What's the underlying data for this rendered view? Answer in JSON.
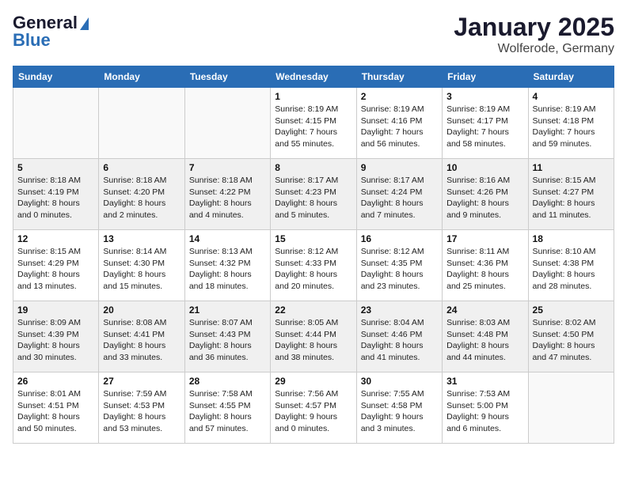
{
  "header": {
    "logo_general": "General",
    "logo_blue": "Blue",
    "month_title": "January 2025",
    "location": "Wolferode, Germany"
  },
  "weekdays": [
    "Sunday",
    "Monday",
    "Tuesday",
    "Wednesday",
    "Thursday",
    "Friday",
    "Saturday"
  ],
  "weeks": [
    {
      "shaded": false,
      "days": [
        {
          "num": "",
          "sunrise": "",
          "sunset": "",
          "daylight": ""
        },
        {
          "num": "",
          "sunrise": "",
          "sunset": "",
          "daylight": ""
        },
        {
          "num": "",
          "sunrise": "",
          "sunset": "",
          "daylight": ""
        },
        {
          "num": "1",
          "sunrise": "Sunrise: 8:19 AM",
          "sunset": "Sunset: 4:15 PM",
          "daylight": "Daylight: 7 hours and 55 minutes."
        },
        {
          "num": "2",
          "sunrise": "Sunrise: 8:19 AM",
          "sunset": "Sunset: 4:16 PM",
          "daylight": "Daylight: 7 hours and 56 minutes."
        },
        {
          "num": "3",
          "sunrise": "Sunrise: 8:19 AM",
          "sunset": "Sunset: 4:17 PM",
          "daylight": "Daylight: 7 hours and 58 minutes."
        },
        {
          "num": "4",
          "sunrise": "Sunrise: 8:19 AM",
          "sunset": "Sunset: 4:18 PM",
          "daylight": "Daylight: 7 hours and 59 minutes."
        }
      ]
    },
    {
      "shaded": true,
      "days": [
        {
          "num": "5",
          "sunrise": "Sunrise: 8:18 AM",
          "sunset": "Sunset: 4:19 PM",
          "daylight": "Daylight: 8 hours and 0 minutes."
        },
        {
          "num": "6",
          "sunrise": "Sunrise: 8:18 AM",
          "sunset": "Sunset: 4:20 PM",
          "daylight": "Daylight: 8 hours and 2 minutes."
        },
        {
          "num": "7",
          "sunrise": "Sunrise: 8:18 AM",
          "sunset": "Sunset: 4:22 PM",
          "daylight": "Daylight: 8 hours and 4 minutes."
        },
        {
          "num": "8",
          "sunrise": "Sunrise: 8:17 AM",
          "sunset": "Sunset: 4:23 PM",
          "daylight": "Daylight: 8 hours and 5 minutes."
        },
        {
          "num": "9",
          "sunrise": "Sunrise: 8:17 AM",
          "sunset": "Sunset: 4:24 PM",
          "daylight": "Daylight: 8 hours and 7 minutes."
        },
        {
          "num": "10",
          "sunrise": "Sunrise: 8:16 AM",
          "sunset": "Sunset: 4:26 PM",
          "daylight": "Daylight: 8 hours and 9 minutes."
        },
        {
          "num": "11",
          "sunrise": "Sunrise: 8:15 AM",
          "sunset": "Sunset: 4:27 PM",
          "daylight": "Daylight: 8 hours and 11 minutes."
        }
      ]
    },
    {
      "shaded": false,
      "days": [
        {
          "num": "12",
          "sunrise": "Sunrise: 8:15 AM",
          "sunset": "Sunset: 4:29 PM",
          "daylight": "Daylight: 8 hours and 13 minutes."
        },
        {
          "num": "13",
          "sunrise": "Sunrise: 8:14 AM",
          "sunset": "Sunset: 4:30 PM",
          "daylight": "Daylight: 8 hours and 15 minutes."
        },
        {
          "num": "14",
          "sunrise": "Sunrise: 8:13 AM",
          "sunset": "Sunset: 4:32 PM",
          "daylight": "Daylight: 8 hours and 18 minutes."
        },
        {
          "num": "15",
          "sunrise": "Sunrise: 8:12 AM",
          "sunset": "Sunset: 4:33 PM",
          "daylight": "Daylight: 8 hours and 20 minutes."
        },
        {
          "num": "16",
          "sunrise": "Sunrise: 8:12 AM",
          "sunset": "Sunset: 4:35 PM",
          "daylight": "Daylight: 8 hours and 23 minutes."
        },
        {
          "num": "17",
          "sunrise": "Sunrise: 8:11 AM",
          "sunset": "Sunset: 4:36 PM",
          "daylight": "Daylight: 8 hours and 25 minutes."
        },
        {
          "num": "18",
          "sunrise": "Sunrise: 8:10 AM",
          "sunset": "Sunset: 4:38 PM",
          "daylight": "Daylight: 8 hours and 28 minutes."
        }
      ]
    },
    {
      "shaded": true,
      "days": [
        {
          "num": "19",
          "sunrise": "Sunrise: 8:09 AM",
          "sunset": "Sunset: 4:39 PM",
          "daylight": "Daylight: 8 hours and 30 minutes."
        },
        {
          "num": "20",
          "sunrise": "Sunrise: 8:08 AM",
          "sunset": "Sunset: 4:41 PM",
          "daylight": "Daylight: 8 hours and 33 minutes."
        },
        {
          "num": "21",
          "sunrise": "Sunrise: 8:07 AM",
          "sunset": "Sunset: 4:43 PM",
          "daylight": "Daylight: 8 hours and 36 minutes."
        },
        {
          "num": "22",
          "sunrise": "Sunrise: 8:05 AM",
          "sunset": "Sunset: 4:44 PM",
          "daylight": "Daylight: 8 hours and 38 minutes."
        },
        {
          "num": "23",
          "sunrise": "Sunrise: 8:04 AM",
          "sunset": "Sunset: 4:46 PM",
          "daylight": "Daylight: 8 hours and 41 minutes."
        },
        {
          "num": "24",
          "sunrise": "Sunrise: 8:03 AM",
          "sunset": "Sunset: 4:48 PM",
          "daylight": "Daylight: 8 hours and 44 minutes."
        },
        {
          "num": "25",
          "sunrise": "Sunrise: 8:02 AM",
          "sunset": "Sunset: 4:50 PM",
          "daylight": "Daylight: 8 hours and 47 minutes."
        }
      ]
    },
    {
      "shaded": false,
      "days": [
        {
          "num": "26",
          "sunrise": "Sunrise: 8:01 AM",
          "sunset": "Sunset: 4:51 PM",
          "daylight": "Daylight: 8 hours and 50 minutes."
        },
        {
          "num": "27",
          "sunrise": "Sunrise: 7:59 AM",
          "sunset": "Sunset: 4:53 PM",
          "daylight": "Daylight: 8 hours and 53 minutes."
        },
        {
          "num": "28",
          "sunrise": "Sunrise: 7:58 AM",
          "sunset": "Sunset: 4:55 PM",
          "daylight": "Daylight: 8 hours and 57 minutes."
        },
        {
          "num": "29",
          "sunrise": "Sunrise: 7:56 AM",
          "sunset": "Sunset: 4:57 PM",
          "daylight": "Daylight: 9 hours and 0 minutes."
        },
        {
          "num": "30",
          "sunrise": "Sunrise: 7:55 AM",
          "sunset": "Sunset: 4:58 PM",
          "daylight": "Daylight: 9 hours and 3 minutes."
        },
        {
          "num": "31",
          "sunrise": "Sunrise: 7:53 AM",
          "sunset": "Sunset: 5:00 PM",
          "daylight": "Daylight: 9 hours and 6 minutes."
        },
        {
          "num": "",
          "sunrise": "",
          "sunset": "",
          "daylight": ""
        }
      ]
    }
  ]
}
